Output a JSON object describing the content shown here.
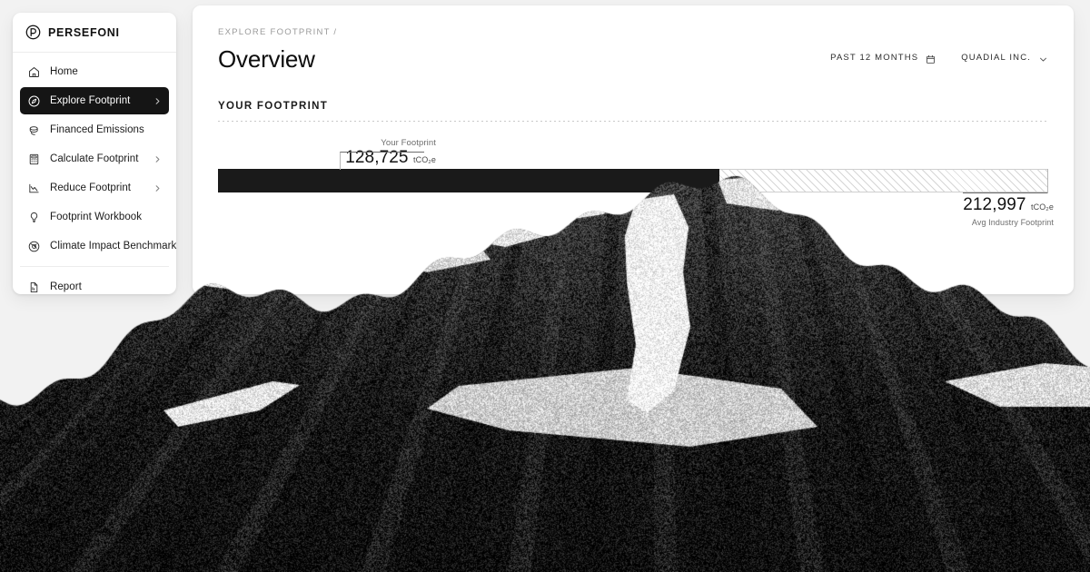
{
  "brand": {
    "name": "PERSEFONI",
    "logo_icon": "persefoni-circle-logo"
  },
  "sidebar": {
    "items": [
      {
        "label": "Home",
        "icon": "home-icon",
        "chevron": false,
        "active": false
      },
      {
        "label": "Explore Footprint",
        "icon": "compass-icon",
        "chevron": true,
        "active": true
      },
      {
        "label": "Financed Emissions",
        "icon": "coins-stack-icon",
        "chevron": false,
        "active": false
      },
      {
        "label": "Calculate Footprint",
        "icon": "calculator-icon",
        "chevron": true,
        "active": false
      },
      {
        "label": "Reduce Footprint",
        "icon": "chart-decline-icon",
        "chevron": true,
        "active": false
      },
      {
        "label": "Footprint Workbook",
        "icon": "lightbulb-icon",
        "chevron": false,
        "active": false
      },
      {
        "label": "Climate Impact Benchmarking",
        "icon": "globe-target-icon",
        "chevron": false,
        "active": false
      }
    ],
    "footer_items": [
      {
        "label": "Report",
        "icon": "document-report-icon",
        "chevron": false,
        "active": false
      }
    ]
  },
  "header": {
    "breadcrumb": "EXPLORE FOOTPRINT /",
    "title": "Overview",
    "date_range": {
      "label": "PAST 12 MONTHS",
      "icon": "calendar-icon"
    },
    "org": {
      "label": "QUADIAL INC.",
      "icon": "chevron-down-icon"
    }
  },
  "main": {
    "section_title": "YOUR FOOTPRINT"
  },
  "chart_data": {
    "type": "bar",
    "orientation": "horizontal",
    "title": "YOUR FOOTPRINT",
    "unit": "tCO₂e",
    "categories": [
      "Your Footprint",
      "Avg Industry Footprint"
    ],
    "values": [
      128725,
      212997
    ],
    "series": [
      {
        "name": "Your Footprint",
        "value": 128725,
        "value_label": "128,725",
        "unit": "tCO₂e",
        "color": "#1a1a1a",
        "style": "solid"
      },
      {
        "name": "Avg Industry Footprint",
        "value": 212997,
        "value_label": "212,997",
        "unit": "tCO₂e",
        "color": "#d6d6d6",
        "style": "diagonal-hatch"
      }
    ],
    "xlim": [
      0,
      212997
    ],
    "grid": false,
    "legend": false,
    "fill_percent": 60.4
  },
  "colors": {
    "page_background": "#f2f2f2",
    "card_background": "#ffffff",
    "accent_dark": "#1a1a1a",
    "muted_text": "#6e6e6e",
    "divider": "#ececec"
  }
}
